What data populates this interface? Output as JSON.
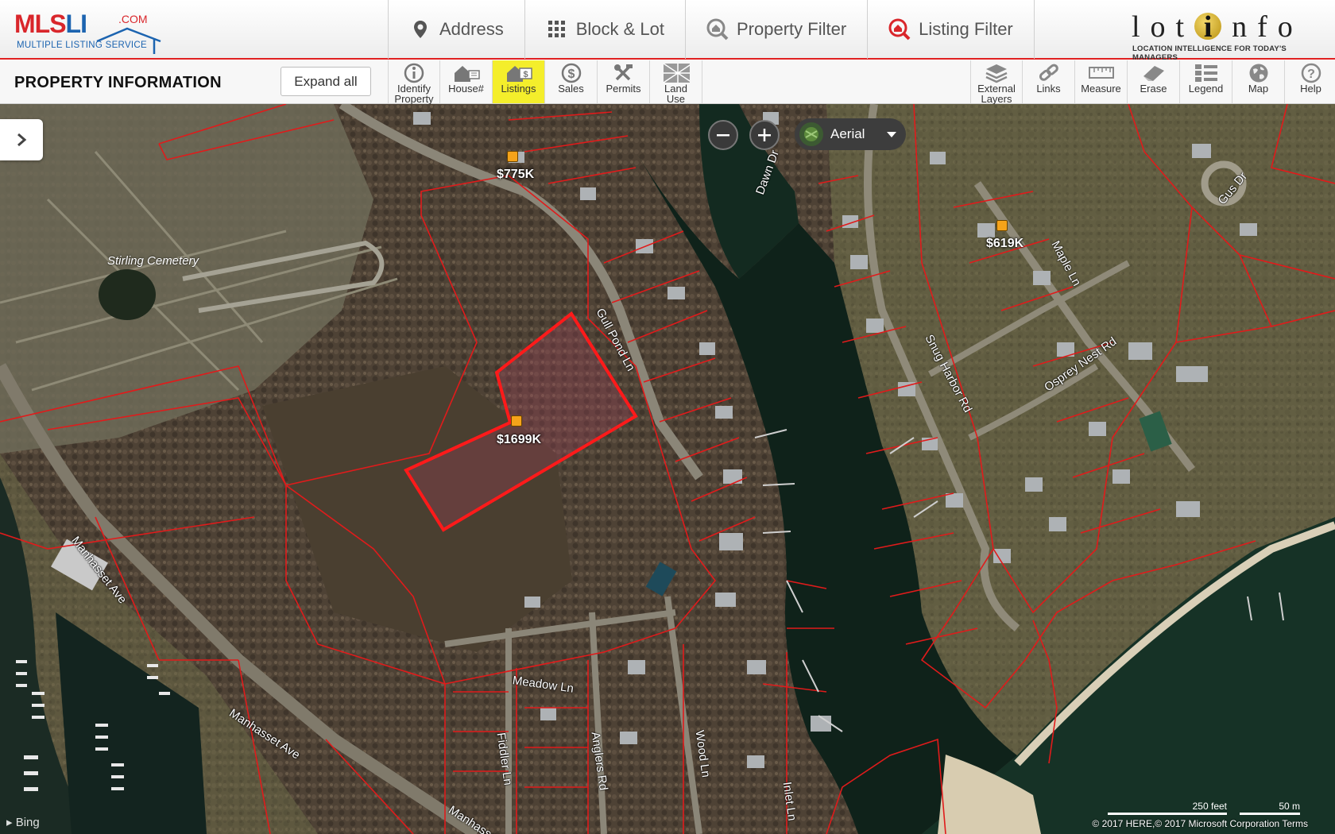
{
  "header": {
    "mls_logo": {
      "word_main": "MLS",
      "word_accent": "LI",
      "com": ".COM",
      "subtitle": "MULTIPLE LISTING SERVICE"
    },
    "nav_tabs": [
      {
        "label": "Address",
        "icon": "map-pin-icon"
      },
      {
        "label": "Block & Lot",
        "icon": "grid-icon"
      },
      {
        "label": "Property Filter",
        "icon": "house-search-icon"
      },
      {
        "label": "Listing Filter",
        "icon": "house-search-red-icon"
      }
    ],
    "lotinfo_logo": {
      "word": "lot nfo",
      "i": "i",
      "tagline": "LOCATION INTELLIGENCE FOR TODAY'S MANAGERS"
    }
  },
  "toolbar": {
    "panel_title": "PROPERTY INFORMATION",
    "expand_all": "Expand all",
    "left_tools": [
      {
        "label": "Identify\nProperty",
        "icon": "info-icon",
        "active": false
      },
      {
        "label": "House#",
        "icon": "house-number-icon",
        "active": false
      },
      {
        "label": "Listings",
        "icon": "listings-icon",
        "active": true
      },
      {
        "label": "Sales",
        "icon": "dollar-icon",
        "active": false
      },
      {
        "label": "Permits",
        "icon": "tools-icon",
        "active": false
      },
      {
        "label": "Land\nUse",
        "icon": "land-use-icon",
        "active": false
      }
    ],
    "right_tools": [
      {
        "label": "External\nLayers",
        "icon": "layers-icon"
      },
      {
        "label": "Links",
        "icon": "link-icon"
      },
      {
        "label": "Measure",
        "icon": "ruler-icon"
      },
      {
        "label": "Erase",
        "icon": "eraser-icon"
      },
      {
        "label": "Legend",
        "icon": "legend-icon"
      },
      {
        "label": "Map",
        "icon": "globe-icon"
      },
      {
        "label": "Help",
        "icon": "help-icon"
      }
    ]
  },
  "map": {
    "map_type": "Aerial",
    "listings": [
      {
        "price": "$775K"
      },
      {
        "price": "$619K"
      },
      {
        "price": "$1699K"
      }
    ],
    "streets": {
      "gull_pond": "Gull Pond Ln",
      "dawn": "Dawn Dr",
      "maple": "Maple Ln",
      "gus": "Gus Dr",
      "snug_harbor": "Snug Harbor Rd",
      "osprey_nest": "Osprey Nest Rd",
      "manhasset_1": "Manhasset Ave",
      "manhasset_2": "Manhasset Ave",
      "manhasset_3": "Manhasset",
      "meadow": "Meadow Ln",
      "fiddler": "Fiddler Ln",
      "anglers": "Anglers Rd",
      "wood": "Wood Ln",
      "inlet": "Inlet Ln"
    },
    "place_label": "Stirling Cemetery",
    "scale": {
      "feet": "250 feet",
      "meters": "50 m"
    },
    "copyright": "© 2017 HERE,© 2017 Microsoft Corporation  Terms",
    "provider": "Bing"
  }
}
